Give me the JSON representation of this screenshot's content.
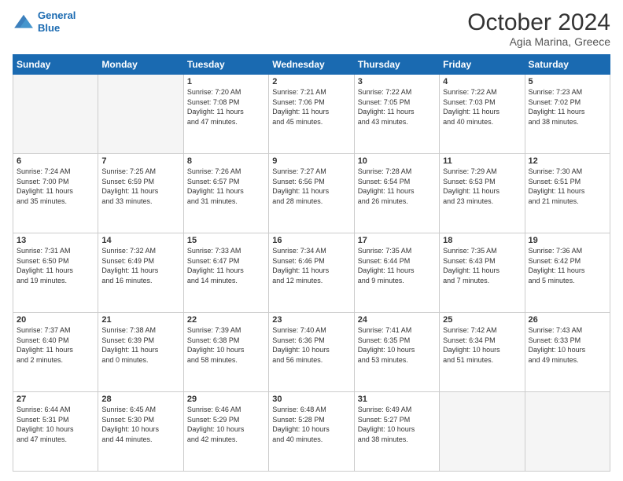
{
  "header": {
    "logo_general": "General",
    "logo_blue": "Blue",
    "month_year": "October 2024",
    "location": "Agia Marina, Greece"
  },
  "days_of_week": [
    "Sunday",
    "Monday",
    "Tuesday",
    "Wednesday",
    "Thursday",
    "Friday",
    "Saturday"
  ],
  "weeks": [
    [
      {
        "num": "",
        "info": ""
      },
      {
        "num": "",
        "info": ""
      },
      {
        "num": "1",
        "info": "Sunrise: 7:20 AM\nSunset: 7:08 PM\nDaylight: 11 hours\nand 47 minutes."
      },
      {
        "num": "2",
        "info": "Sunrise: 7:21 AM\nSunset: 7:06 PM\nDaylight: 11 hours\nand 45 minutes."
      },
      {
        "num": "3",
        "info": "Sunrise: 7:22 AM\nSunset: 7:05 PM\nDaylight: 11 hours\nand 43 minutes."
      },
      {
        "num": "4",
        "info": "Sunrise: 7:22 AM\nSunset: 7:03 PM\nDaylight: 11 hours\nand 40 minutes."
      },
      {
        "num": "5",
        "info": "Sunrise: 7:23 AM\nSunset: 7:02 PM\nDaylight: 11 hours\nand 38 minutes."
      }
    ],
    [
      {
        "num": "6",
        "info": "Sunrise: 7:24 AM\nSunset: 7:00 PM\nDaylight: 11 hours\nand 35 minutes."
      },
      {
        "num": "7",
        "info": "Sunrise: 7:25 AM\nSunset: 6:59 PM\nDaylight: 11 hours\nand 33 minutes."
      },
      {
        "num": "8",
        "info": "Sunrise: 7:26 AM\nSunset: 6:57 PM\nDaylight: 11 hours\nand 31 minutes."
      },
      {
        "num": "9",
        "info": "Sunrise: 7:27 AM\nSunset: 6:56 PM\nDaylight: 11 hours\nand 28 minutes."
      },
      {
        "num": "10",
        "info": "Sunrise: 7:28 AM\nSunset: 6:54 PM\nDaylight: 11 hours\nand 26 minutes."
      },
      {
        "num": "11",
        "info": "Sunrise: 7:29 AM\nSunset: 6:53 PM\nDaylight: 11 hours\nand 23 minutes."
      },
      {
        "num": "12",
        "info": "Sunrise: 7:30 AM\nSunset: 6:51 PM\nDaylight: 11 hours\nand 21 minutes."
      }
    ],
    [
      {
        "num": "13",
        "info": "Sunrise: 7:31 AM\nSunset: 6:50 PM\nDaylight: 11 hours\nand 19 minutes."
      },
      {
        "num": "14",
        "info": "Sunrise: 7:32 AM\nSunset: 6:49 PM\nDaylight: 11 hours\nand 16 minutes."
      },
      {
        "num": "15",
        "info": "Sunrise: 7:33 AM\nSunset: 6:47 PM\nDaylight: 11 hours\nand 14 minutes."
      },
      {
        "num": "16",
        "info": "Sunrise: 7:34 AM\nSunset: 6:46 PM\nDaylight: 11 hours\nand 12 minutes."
      },
      {
        "num": "17",
        "info": "Sunrise: 7:35 AM\nSunset: 6:44 PM\nDaylight: 11 hours\nand 9 minutes."
      },
      {
        "num": "18",
        "info": "Sunrise: 7:35 AM\nSunset: 6:43 PM\nDaylight: 11 hours\nand 7 minutes."
      },
      {
        "num": "19",
        "info": "Sunrise: 7:36 AM\nSunset: 6:42 PM\nDaylight: 11 hours\nand 5 minutes."
      }
    ],
    [
      {
        "num": "20",
        "info": "Sunrise: 7:37 AM\nSunset: 6:40 PM\nDaylight: 11 hours\nand 2 minutes."
      },
      {
        "num": "21",
        "info": "Sunrise: 7:38 AM\nSunset: 6:39 PM\nDaylight: 11 hours\nand 0 minutes."
      },
      {
        "num": "22",
        "info": "Sunrise: 7:39 AM\nSunset: 6:38 PM\nDaylight: 10 hours\nand 58 minutes."
      },
      {
        "num": "23",
        "info": "Sunrise: 7:40 AM\nSunset: 6:36 PM\nDaylight: 10 hours\nand 56 minutes."
      },
      {
        "num": "24",
        "info": "Sunrise: 7:41 AM\nSunset: 6:35 PM\nDaylight: 10 hours\nand 53 minutes."
      },
      {
        "num": "25",
        "info": "Sunrise: 7:42 AM\nSunset: 6:34 PM\nDaylight: 10 hours\nand 51 minutes."
      },
      {
        "num": "26",
        "info": "Sunrise: 7:43 AM\nSunset: 6:33 PM\nDaylight: 10 hours\nand 49 minutes."
      }
    ],
    [
      {
        "num": "27",
        "info": "Sunrise: 6:44 AM\nSunset: 5:31 PM\nDaylight: 10 hours\nand 47 minutes."
      },
      {
        "num": "28",
        "info": "Sunrise: 6:45 AM\nSunset: 5:30 PM\nDaylight: 10 hours\nand 44 minutes."
      },
      {
        "num": "29",
        "info": "Sunrise: 6:46 AM\nSunset: 5:29 PM\nDaylight: 10 hours\nand 42 minutes."
      },
      {
        "num": "30",
        "info": "Sunrise: 6:48 AM\nSunset: 5:28 PM\nDaylight: 10 hours\nand 40 minutes."
      },
      {
        "num": "31",
        "info": "Sunrise: 6:49 AM\nSunset: 5:27 PM\nDaylight: 10 hours\nand 38 minutes."
      },
      {
        "num": "",
        "info": ""
      },
      {
        "num": "",
        "info": ""
      }
    ]
  ]
}
